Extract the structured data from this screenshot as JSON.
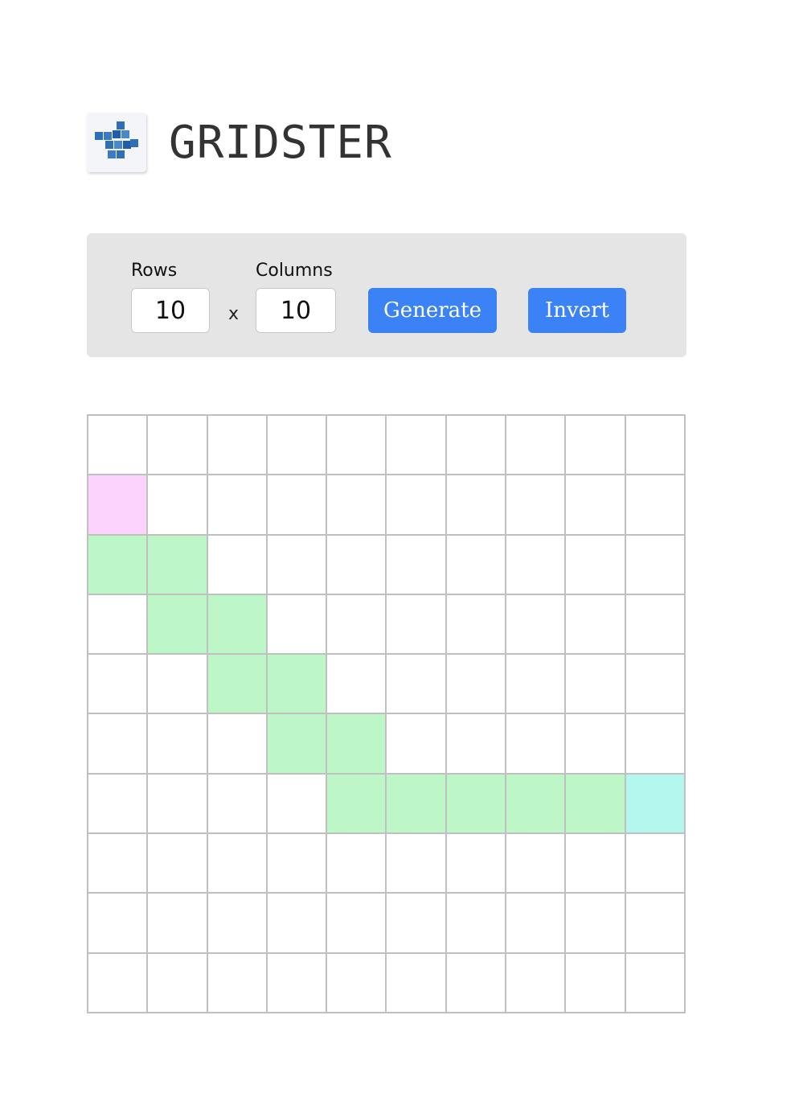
{
  "app": {
    "title": "GRIDSTER",
    "logo_icon": "grid-blocks-icon"
  },
  "controls": {
    "rows_label": "Rows",
    "rows_value": "10",
    "times_label": "x",
    "columns_label": "Columns",
    "columns_value": "10",
    "generate_label": "Generate",
    "invert_label": "Invert"
  },
  "colors": {
    "button": "#3b82f6",
    "panel": "#e5e5e5",
    "grid_line": "#c0c0c0",
    "empty": "#ffffff",
    "start": "#fcd3fc",
    "path": "#bdf7c8",
    "end": "#b3f7ee"
  },
  "grid": {
    "rows": 10,
    "columns": 10,
    "start": [
      1,
      0
    ],
    "end": [
      6,
      9
    ],
    "path": [
      [
        2,
        0
      ],
      [
        2,
        1
      ],
      [
        3,
        1
      ],
      [
        3,
        2
      ],
      [
        4,
        2
      ],
      [
        4,
        3
      ],
      [
        5,
        3
      ],
      [
        5,
        4
      ],
      [
        6,
        4
      ],
      [
        6,
        5
      ],
      [
        6,
        6
      ],
      [
        6,
        7
      ],
      [
        6,
        8
      ]
    ]
  }
}
